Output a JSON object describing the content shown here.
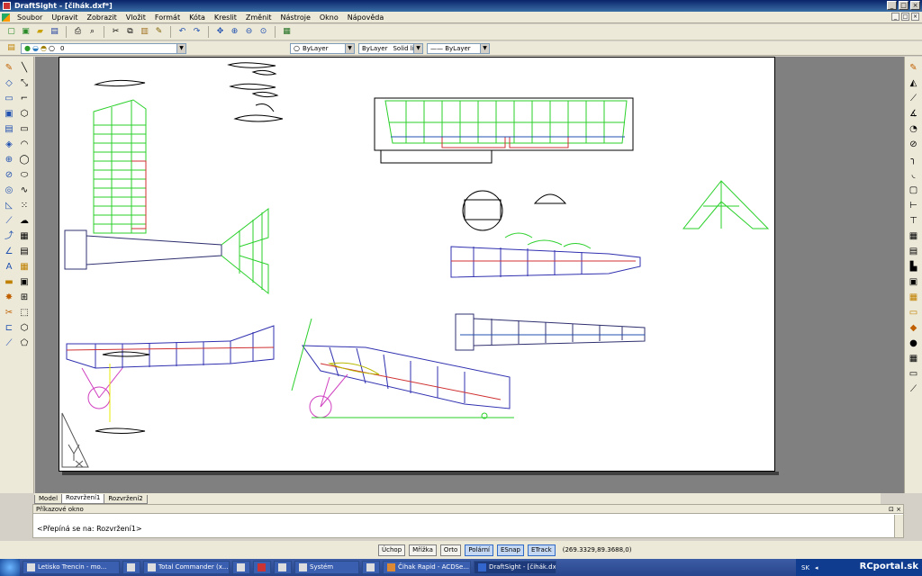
{
  "window": {
    "title": "DraftSight - [čihák.dxf*]",
    "controls": [
      "_",
      "□",
      "×"
    ]
  },
  "menu": {
    "items": [
      "Soubor",
      "Upravit",
      "Zobrazit",
      "Vložit",
      "Formát",
      "Kóta",
      "Kreslit",
      "Změnit",
      "Nástroje",
      "Okno",
      "Nápověda"
    ]
  },
  "layer_bar": {
    "layer": "0",
    "color": "ByLayer",
    "linestyle_by": "ByLayer",
    "linestyle": "Solid line",
    "lineweight": "—— ByLayer"
  },
  "tabs": [
    "Model",
    "Rozvržení1",
    "Rozvržení2"
  ],
  "active_tab": "Rozvržení1",
  "command": {
    "header": "Příkazové okno",
    "line": "<Přepíná se na: Rozvržení1>"
  },
  "status": {
    "buttons": [
      "Úchop",
      "Mřížka",
      "Orto",
      "Polární",
      "ESnap",
      "ETrack"
    ],
    "active_buttons": [
      "Polární",
      "ESnap",
      "ETrack"
    ],
    "coords": "(269.3329,89.3688,0)"
  },
  "taskbar": {
    "tasks": [
      "Letisko Trencin - mo...",
      "",
      "Total Commander (x...",
      "",
      "",
      "",
      "Systém",
      "",
      "Čihak Rapid - ACDSe...",
      "DraftSight - [čihák.dx..."
    ],
    "lang": "SK",
    "watermark": "RCportal.sk"
  }
}
